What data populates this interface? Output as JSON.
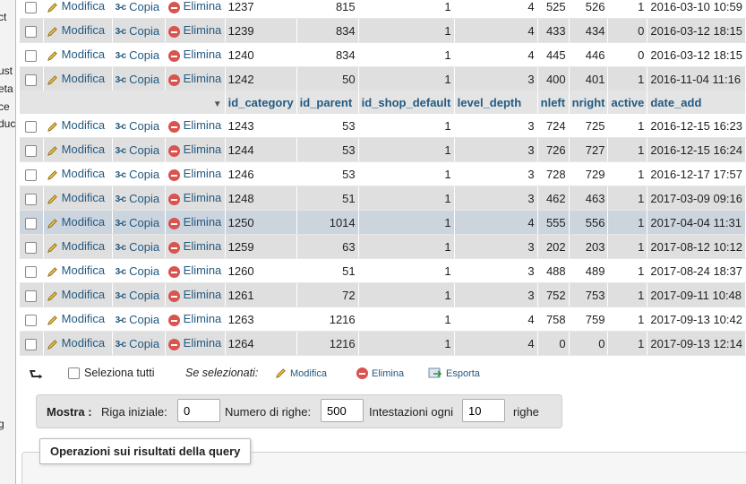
{
  "sidebar": {
    "fragments": [
      "ct",
      "ust",
      "eta",
      "ce",
      "duc",
      "g"
    ]
  },
  "actions": {
    "edit": "Modifica",
    "copy": "Copia",
    "delete": "Elimina"
  },
  "table": {
    "columns": [
      "id_category",
      "id_parent",
      "id_shop_default",
      "level_depth",
      "nleft",
      "nright",
      "active",
      "date_add"
    ],
    "rows_top": [
      {
        "id_category": "1237",
        "id_parent": "815",
        "id_shop_default": "1",
        "level_depth": "4",
        "nleft": "525",
        "nright": "526",
        "active": "1",
        "date_add": "2016-03-10 10:59"
      },
      {
        "id_category": "1239",
        "id_parent": "834",
        "id_shop_default": "1",
        "level_depth": "4",
        "nleft": "433",
        "nright": "434",
        "active": "0",
        "date_add": "2016-03-12 18:15"
      },
      {
        "id_category": "1240",
        "id_parent": "834",
        "id_shop_default": "1",
        "level_depth": "4",
        "nleft": "445",
        "nright": "446",
        "active": "0",
        "date_add": "2016-03-12 18:15"
      },
      {
        "id_category": "1242",
        "id_parent": "50",
        "id_shop_default": "1",
        "level_depth": "3",
        "nleft": "400",
        "nright": "401",
        "active": "1",
        "date_add": "2016-11-04 11:16"
      }
    ],
    "rows_bottom": [
      {
        "id_category": "1243",
        "id_parent": "53",
        "id_shop_default": "1",
        "level_depth": "3",
        "nleft": "724",
        "nright": "725",
        "active": "1",
        "date_add": "2016-12-15 16:23"
      },
      {
        "id_category": "1244",
        "id_parent": "53",
        "id_shop_default": "1",
        "level_depth": "3",
        "nleft": "726",
        "nright": "727",
        "active": "1",
        "date_add": "2016-12-15 16:24"
      },
      {
        "id_category": "1246",
        "id_parent": "53",
        "id_shop_default": "1",
        "level_depth": "3",
        "nleft": "728",
        "nright": "729",
        "active": "1",
        "date_add": "2016-12-17 17:57"
      },
      {
        "id_category": "1248",
        "id_parent": "51",
        "id_shop_default": "1",
        "level_depth": "3",
        "nleft": "462",
        "nright": "463",
        "active": "1",
        "date_add": "2017-03-09 09:16"
      },
      {
        "id_category": "1250",
        "id_parent": "1014",
        "id_shop_default": "1",
        "level_depth": "4",
        "nleft": "555",
        "nright": "556",
        "active": "1",
        "date_add": "2017-04-04 11:31"
      },
      {
        "id_category": "1259",
        "id_parent": "63",
        "id_shop_default": "1",
        "level_depth": "3",
        "nleft": "202",
        "nright": "203",
        "active": "1",
        "date_add": "2017-08-12 10:12"
      },
      {
        "id_category": "1260",
        "id_parent": "51",
        "id_shop_default": "1",
        "level_depth": "3",
        "nleft": "488",
        "nright": "489",
        "active": "1",
        "date_add": "2017-08-24 18:37"
      },
      {
        "id_category": "1261",
        "id_parent": "72",
        "id_shop_default": "1",
        "level_depth": "3",
        "nleft": "752",
        "nright": "753",
        "active": "1",
        "date_add": "2017-09-11 10:48"
      },
      {
        "id_category": "1263",
        "id_parent": "1216",
        "id_shop_default": "1",
        "level_depth": "4",
        "nleft": "758",
        "nright": "759",
        "active": "1",
        "date_add": "2017-09-13 10:42"
      },
      {
        "id_category": "1264",
        "id_parent": "1216",
        "id_shop_default": "1",
        "level_depth": "4",
        "nleft": "0",
        "nright": "0",
        "active": "1",
        "date_add": "2017-09-13 12:14"
      }
    ]
  },
  "bulk": {
    "select_all": "Seleziona tutti",
    "if_selected": "Se selezionati:",
    "edit": "Modifica",
    "delete": "Elimina",
    "export": "Esporta"
  },
  "nav": {
    "show_label": "Mostra :",
    "start_row_label": "Riga iniziale:",
    "start_row_value": "0",
    "num_rows_label": "Numero di righe:",
    "num_rows_value": "500",
    "headers_every_label": "Intestazioni ogni",
    "headers_every_value": "10",
    "rows_suffix": "righe"
  },
  "operations": {
    "legend": "Operazioni sui risultati della query"
  },
  "colors": {
    "link": "#235a81",
    "row_even": "#dfdfdf",
    "row_highlight": "#ccd4de",
    "delete_icon": "#d9534f"
  }
}
